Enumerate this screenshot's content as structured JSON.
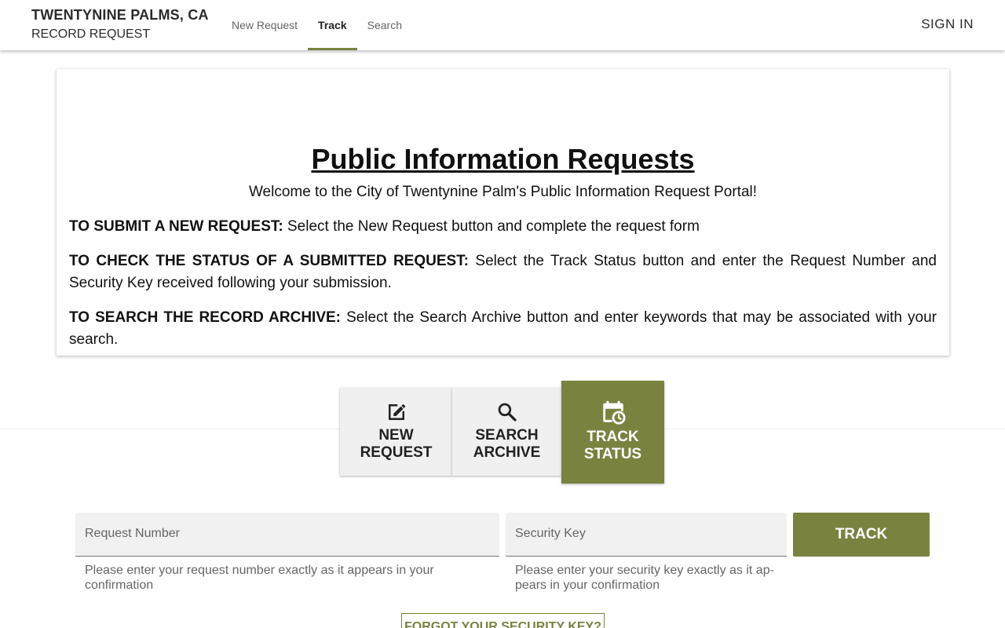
{
  "header": {
    "title": "TWENTYNINE PALMS, CA",
    "subtitle": "RECORD REQUEST",
    "nav": [
      {
        "label": "New Request"
      },
      {
        "label": "Track"
      },
      {
        "label": "Search"
      }
    ],
    "active_tab": "Track",
    "sign_in": "SIGN IN"
  },
  "card": {
    "title": "Public Information Requests",
    "welcome": "Welcome to the City of Twentynine Palm's Public Information Request Portal!",
    "paragraphs": [
      {
        "lead": "TO SUBMIT A NEW REQUEST:",
        "text": " Select the New Request button and complete the request form"
      },
      {
        "lead": "TO CHECK THE STATUS OF A SUBMITTED REQUEST:",
        "text": " Select the Track Status button and enter the Request Number and Security Key received following your submission."
      },
      {
        "lead": "TO SEARCH THE RECORD ARCHIVE:",
        "text": " Select the Search Archive button and enter keywords that may be associated with your search."
      }
    ]
  },
  "actions": {
    "new_request": {
      "line1": "NEW",
      "line2": "REQUEST",
      "icon": "edit-icon"
    },
    "search_archive": {
      "line1": "SEARCH",
      "line2": "ARCHIVE",
      "icon": "search-icon"
    },
    "track_status": {
      "line1": "TRACK",
      "line2": "STATUS",
      "icon": "calendar-clock-icon"
    }
  },
  "form": {
    "request_number": {
      "placeholder": "Request Number",
      "hint": "Please enter your request number exactly as it appears in your confirmation"
    },
    "security_key": {
      "placeholder": "Security Key",
      "hint": "Please enter your security key exactly as it ap­pears in your confirmation"
    },
    "track_button": "TRACK",
    "forgot_button": "FORGOT YOUR SECURITY KEY?"
  },
  "colors": {
    "accent": "#7a8240",
    "button_bg": "#f0f0f0"
  }
}
